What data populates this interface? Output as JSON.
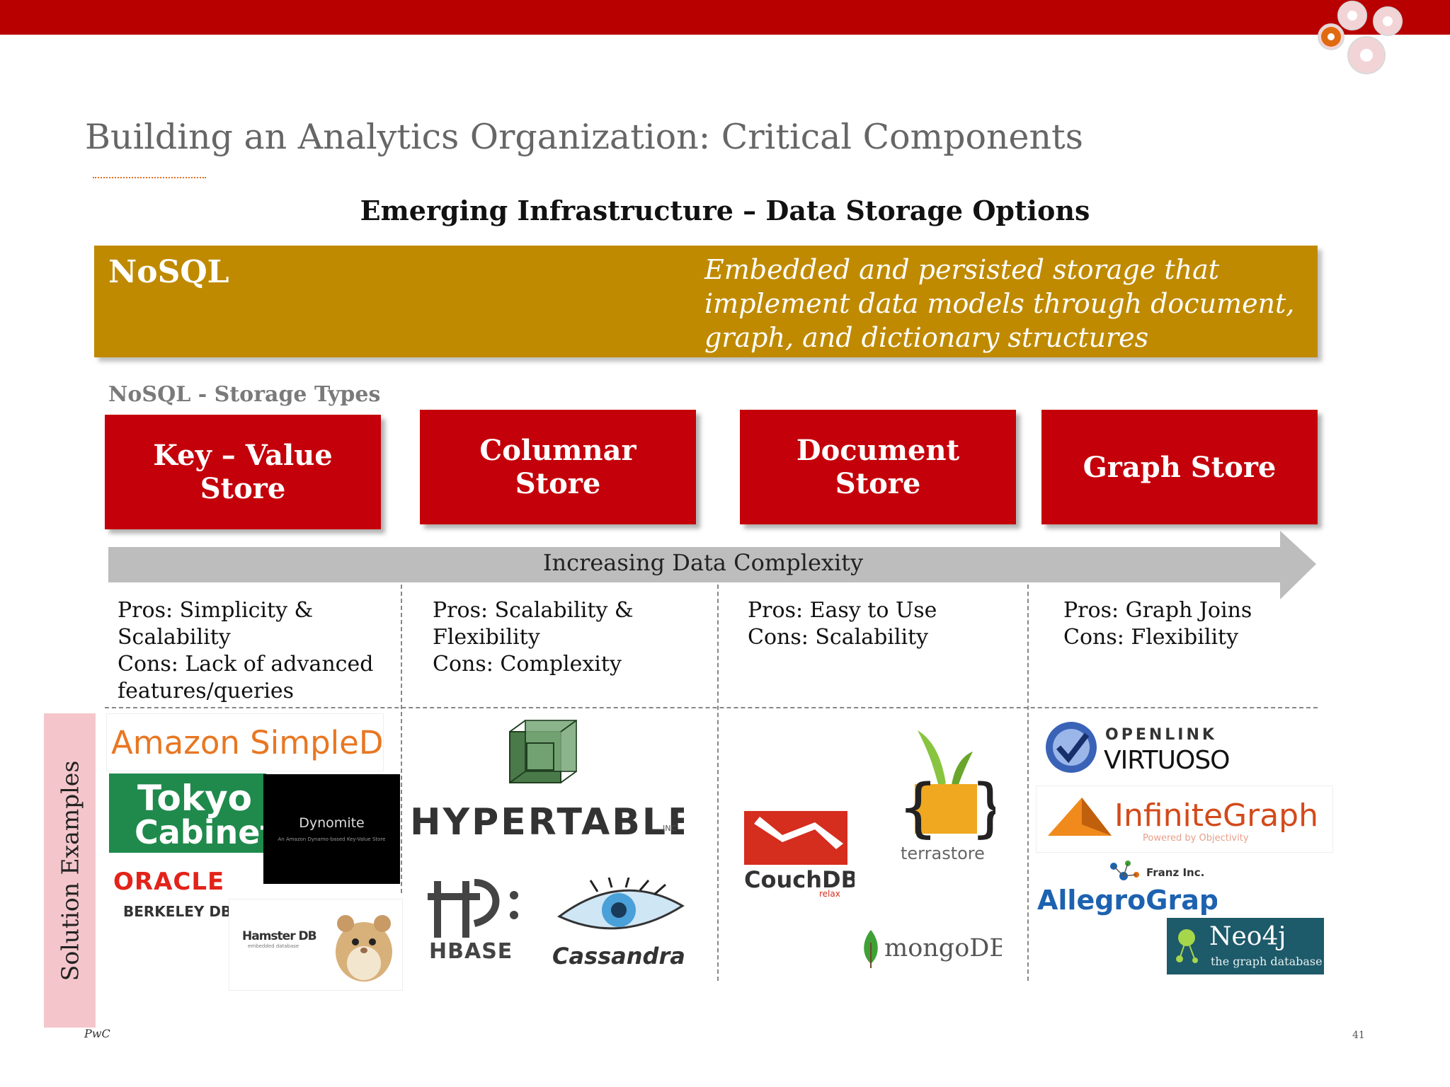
{
  "header": {
    "bar_color": "#b80000",
    "gears_icon": "gears-icon"
  },
  "title": "Building an Analytics Organization: Critical Components",
  "subtitle": "Emerging Infrastructure – Data Storage Options",
  "nosql": {
    "label": "NoSQL",
    "description": "Embedded and persisted storage that implement data models through document, graph, and dictionary structures",
    "color": "#bf8a00"
  },
  "types_label": "NoSQL - Storage Types",
  "storage_types": [
    {
      "label": "Key – Value Store"
    },
    {
      "label": "Columnar Store"
    },
    {
      "label": "Document Store"
    },
    {
      "label": "Graph Store"
    }
  ],
  "complexity_arrow": "Increasing Data Complexity",
  "pros_cons": [
    {
      "text": "Pros: Simplicity &\nScalability\nCons: Lack of advanced\nfeatures/queries"
    },
    {
      "text": "Pros: Scalability &\nFlexibility\nCons: Complexity"
    },
    {
      "text": "Pros: Easy to Use\nCons:   Scalability"
    },
    {
      "text": "Pros: Graph Joins\nCons: Flexibility"
    }
  ],
  "solution_label": "Solution Examples",
  "logos": {
    "amazon": "Amazon SimpleDB",
    "tokyo_1": "Tokyo",
    "tokyo_2": "Cabinet",
    "dynomite": "Dynomite",
    "dynomite_sub": "An Amazon Dynamo-based Key-Value Store",
    "oracle": "ORACLE",
    "berkeley": "BERKELEY DB",
    "hamster": "Hamster DB",
    "hamster_sub": "embedded database",
    "hypertable": "HYPERTABLE",
    "hypertable_inc": "INC",
    "hbase": "HBASE",
    "cassandra": "Cassandra",
    "couchdb": "CouchDB",
    "couchdb_sub": "relax",
    "terrastore": "terrastore",
    "mongodb": "mongoDB",
    "openlink": "OPENLINK",
    "virtuoso": "VIRTUOSO",
    "infinitegraph": "InfiniteGraph",
    "infinitegraph_sub": "Powered by Objectivity",
    "franz": "Franz Inc.",
    "allegrograph": "AllegroGraph",
    "neo4j": "Neo4j",
    "neo4j_sub": "the graph database"
  },
  "footer": {
    "left": "PwC",
    "page": "41"
  }
}
